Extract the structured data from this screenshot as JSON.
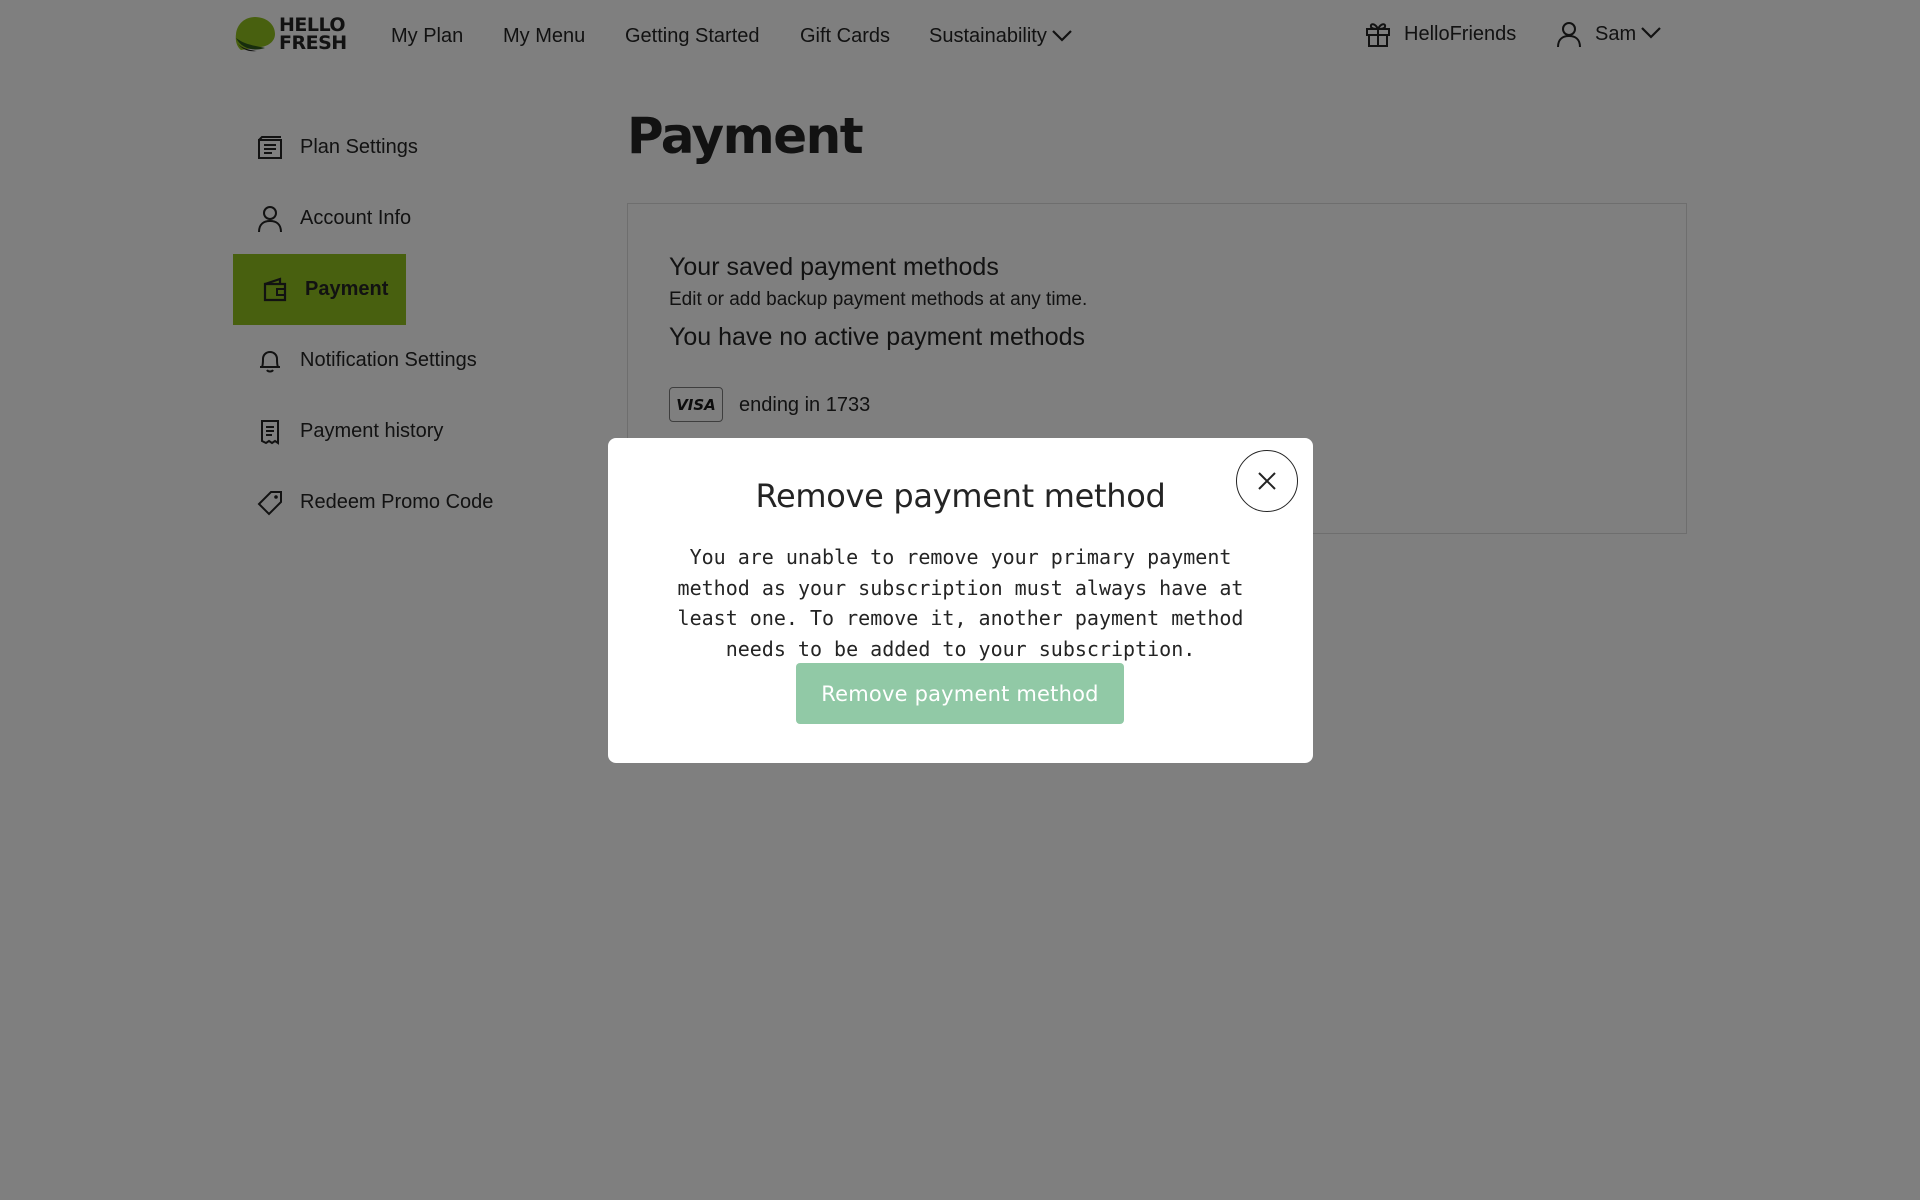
{
  "brand": {
    "logo_line1": "HELLO",
    "logo_line2": "FRESH",
    "accent": "#91c11e"
  },
  "nav": {
    "links": [
      "My Plan",
      "My Menu",
      "Getting Started",
      "Gift Cards",
      "Sustainability"
    ],
    "hellofriends": "HelloFriends",
    "user": "Sam"
  },
  "sidebar": {
    "items": [
      {
        "label": "Plan Settings",
        "icon": "plan-settings-icon"
      },
      {
        "label": "Account Info",
        "icon": "person-icon"
      },
      {
        "label": "Payment",
        "icon": "wallet-icon",
        "active": true
      },
      {
        "label": "Notification Settings",
        "icon": "bell-icon"
      },
      {
        "label": "Payment history",
        "icon": "receipt-icon"
      },
      {
        "label": "Redeem Promo Code",
        "icon": "tag-icon"
      }
    ]
  },
  "main": {
    "title": "Payment",
    "card": {
      "heading": "Your saved payment methods",
      "subtext": "Edit or add backup payment methods at any time.",
      "status": "You have no active payment methods",
      "card_brand": "VISA",
      "card_text": "ending in 1733"
    }
  },
  "modal": {
    "title": "Remove payment method",
    "body": "You are unable to remove your primary payment method as your subscription must always have at least one. To remove it, another payment method needs to be added to your subscription.",
    "button": "Remove payment method",
    "button_color": "#91c9a6"
  }
}
